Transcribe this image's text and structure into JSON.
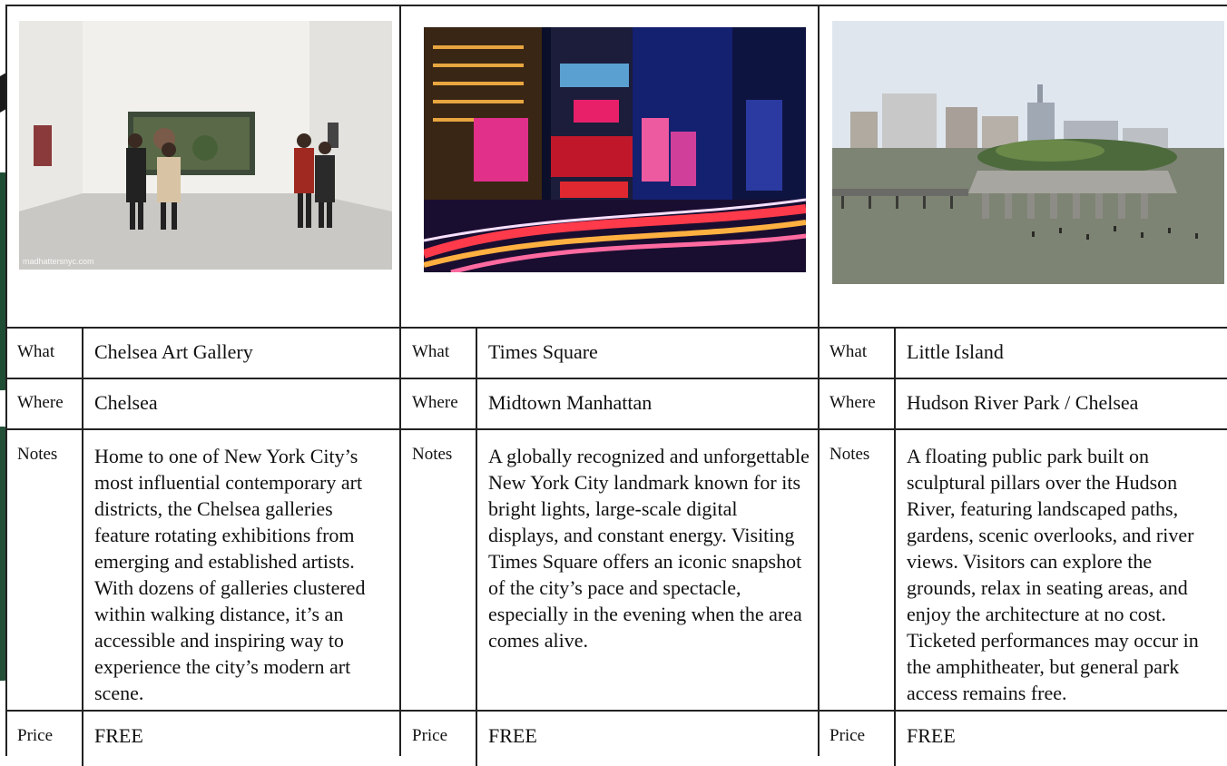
{
  "attractions": [
    {
      "photo": "Two couples viewing a large aerial photograph in a white gallery room",
      "watermark": "madhattersnyc.com",
      "what_label": "What",
      "what": "Chelsea Art Gallery",
      "where_label": "Where",
      "where": "Chelsea",
      "notes_label": "Notes",
      "notes": "Home to one of New York City’s most influential contemporary art districts, the Chelsea galleries feature rotating exhibitions from emerging and established artists. With dozens of galleries clustered within walking distance, it’s an accessible and inspiring way to experience the city’s modern art scene.",
      "price_label": "Price",
      "price": "FREE"
    },
    {
      "photo": "Times Square at night with illuminated billboards and light trails",
      "what_label": "What",
      "what": "Times Square",
      "where_label": "Where",
      "where": "Midtown Manhattan",
      "notes_label": "Notes",
      "notes": "A globally recognized and unforgettable New York City landmark known for its bright lights, large-scale digital displays, and constant energy. Visiting Times Square offers an iconic snapshot of the city’s pace and spectacle, especially in the evening when the area comes alive.",
      "price_label": "Price",
      "price": "FREE"
    },
    {
      "photo": "Little Island floating park on pillars in the Hudson River with Manhattan skyline",
      "what_label": "What",
      "what": "Little Island",
      "where_label": "Where",
      "where": "Hudson River Park / Chelsea",
      "notes_label": "Notes",
      "notes": "A floating public park built on sculptural pillars over the Hudson River, featuring landscaped paths, gardens, scenic overlooks, and river views. Visitors can explore the grounds, relax in seating areas, and enjoy the architecture at no cost. Ticketed performances may occur in the amphitheater, but general park access remains free.",
      "price_label": "Price",
      "price": "FREE"
    }
  ]
}
